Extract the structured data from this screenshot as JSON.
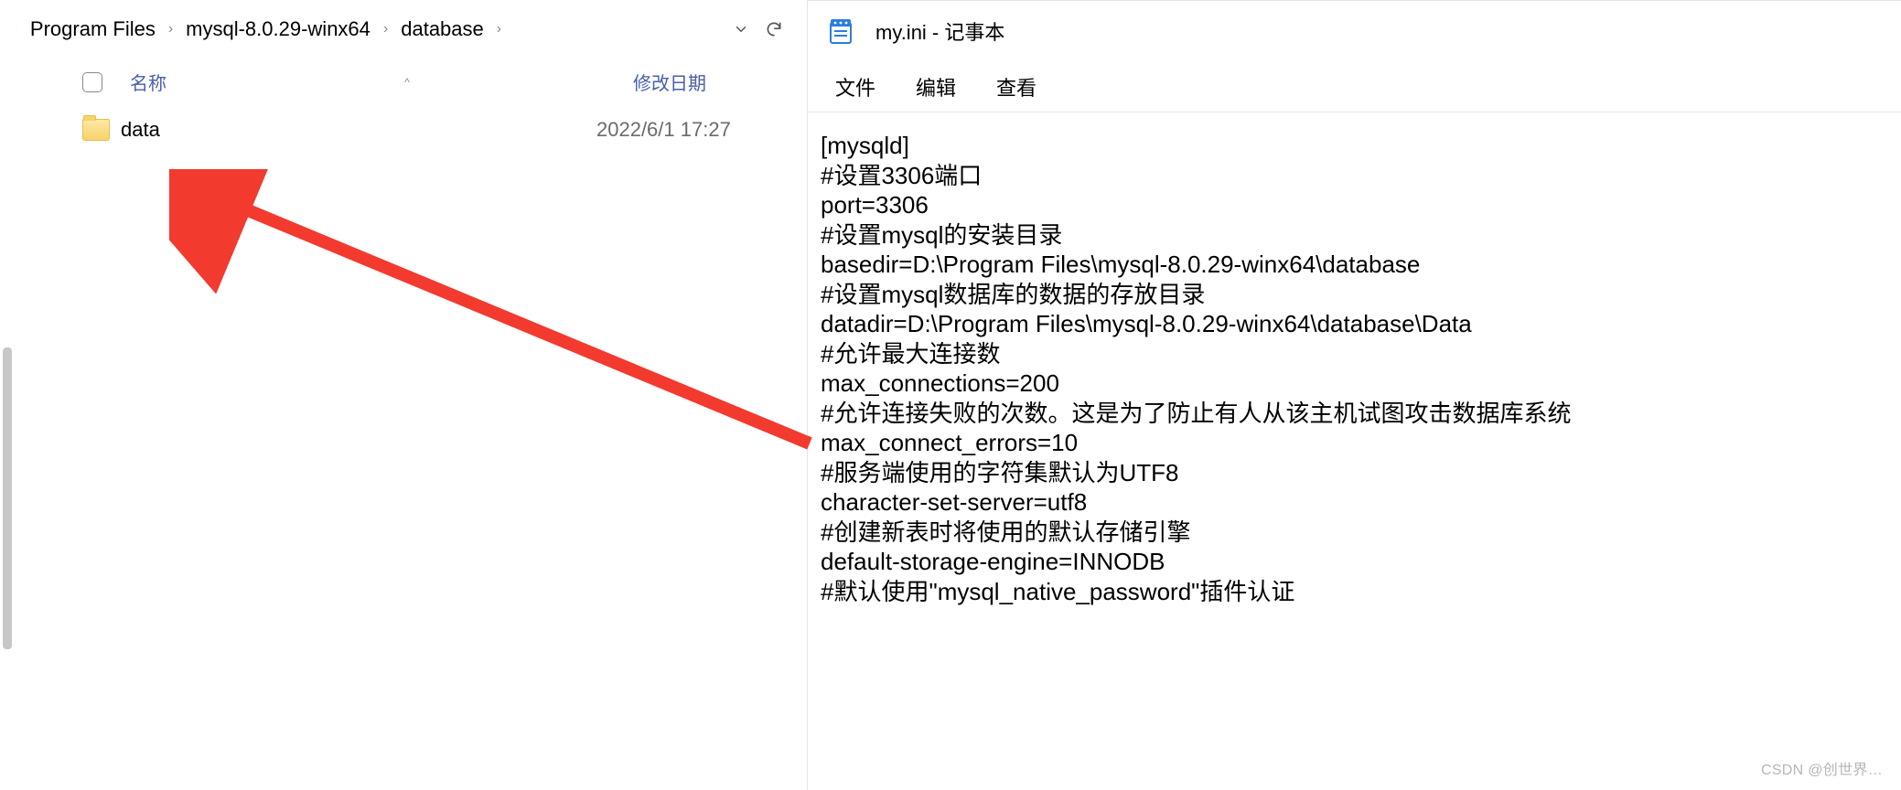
{
  "explorer": {
    "breadcrumbs": {
      "prefix": "«",
      "segments": [
        "Program Files",
        "mysql-8.0.29-winx64",
        "database"
      ],
      "separator": "›"
    },
    "columns": {
      "name": "名称",
      "date": "修改日期",
      "sort_indicator": "^"
    },
    "items": [
      {
        "name": "data",
        "date": "2022/6/1 17:27"
      }
    ]
  },
  "notepad": {
    "title": "my.ini - 记事本",
    "menu": {
      "file": "文件",
      "edit": "编辑",
      "view": "查看"
    },
    "content": "[mysqld]\n#设置3306端口\nport=3306\n#设置mysql的安装目录\nbasedir=D:\\Program Files\\mysql-8.0.29-winx64\\database\n#设置mysql数据库的数据的存放目录\ndatadir=D:\\Program Files\\mysql-8.0.29-winx64\\database\\Data\n#允许最大连接数\nmax_connections=200\n#允许连接失败的次数。这是为了防止有人从该主机试图攻击数据库系统\nmax_connect_errors=10\n#服务端使用的字符集默认为UTF8\ncharacter-set-server=utf8\n#创建新表时将使用的默认存储引擎\ndefault-storage-engine=INNODB\n#默认使用\"mysql_native_password\"插件认证"
  },
  "watermark": "CSDN @创世界…"
}
